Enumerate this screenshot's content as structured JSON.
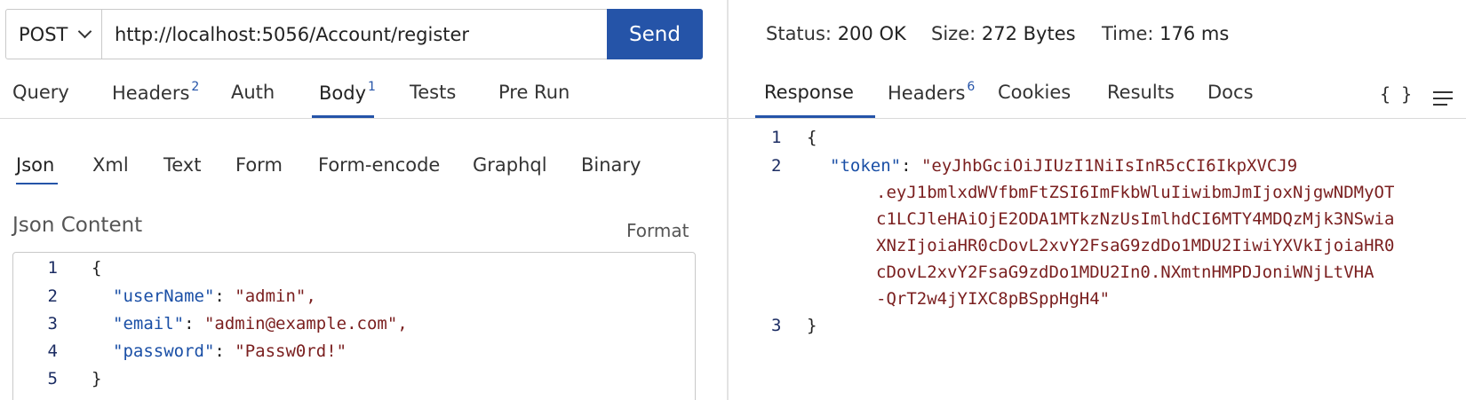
{
  "request": {
    "method": "POST",
    "url": "http://localhost:5056/Account/register",
    "send_label": "Send",
    "tabs": [
      {
        "label": "Query",
        "badge": ""
      },
      {
        "label": "Headers",
        "badge": "2"
      },
      {
        "label": "Auth",
        "badge": ""
      },
      {
        "label": "Body",
        "badge": "1"
      },
      {
        "label": "Tests",
        "badge": ""
      },
      {
        "label": "Pre Run",
        "badge": ""
      }
    ],
    "body_tabs": [
      "Json",
      "Xml",
      "Text",
      "Form",
      "Form-encode",
      "Graphql",
      "Binary"
    ],
    "content_label": "Json Content",
    "format_label": "Format",
    "code_lines": [
      {
        "num": "1",
        "text": "{"
      },
      {
        "num": "2",
        "key": "\"userName\"",
        "value": "\"admin\","
      },
      {
        "num": "3",
        "key": "\"email\"",
        "value": "\"admin@example.com\","
      },
      {
        "num": "4",
        "key": "\"password\"",
        "value": "\"Passw0rd!\""
      },
      {
        "num": "5",
        "text": "}"
      }
    ]
  },
  "response": {
    "status_label": "Status:",
    "status_value": "200 OK",
    "size_label": "Size:",
    "size_value": "272 Bytes",
    "time_label": "Time:",
    "time_value": "176 ms",
    "tabs": [
      {
        "label": "Response",
        "badge": ""
      },
      {
        "label": "Headers",
        "badge": "6"
      },
      {
        "label": "Cookies",
        "badge": ""
      },
      {
        "label": "Results",
        "badge": ""
      },
      {
        "label": "Docs",
        "badge": ""
      }
    ],
    "braces_icon": "{ }",
    "menu_icon": "menu-icon",
    "code": {
      "line1": {
        "num": "1",
        "text": "{"
      },
      "line2": {
        "num": "2",
        "key": "\"token\"",
        "value_parts": [
          "\"eyJhbGciOiJIUzI1NiIsInR5cCI6IkpXVCJ9",
          ".eyJ1bmlxdWVfbmFtZSI6ImFkbWluIiwibmJmIjoxNjgwNDMyOT",
          "c1LCJleHAiOjE2ODA1MTkzNzUsImlhdCI6MTY4MDQzMjk3NSwia",
          "XNzIjoiaHR0cDovL2xvY2FsaG9zdDo1MDU2IiwiYXVkIjoiaHR0",
          "cDovL2xvY2FsaG9zdDo1MDU2In0.NXmtnHMPDJoniWNjLtVHA",
          "-QrT2w4jYIXC8pBSppHgH4\""
        ]
      },
      "line3": {
        "num": "3",
        "text": "}"
      }
    }
  },
  "colors": {
    "accent": "#2554a8",
    "json_key": "#1a4fa6",
    "json_string": "#7a1f1f"
  }
}
